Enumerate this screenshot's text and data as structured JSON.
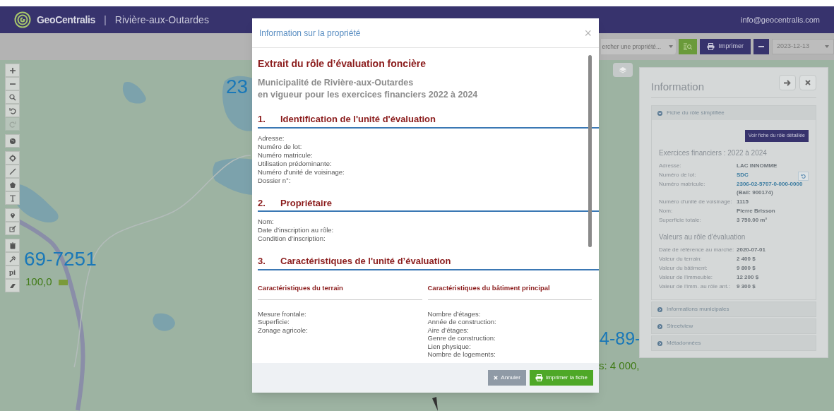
{
  "header": {
    "brand": "GeoCentralis",
    "separator": "|",
    "municipality": "Rivière-aux-Outardes",
    "email": "info@geocentralis.com"
  },
  "toolbar": {
    "search": {
      "value": "ercher une propriété..."
    },
    "print_button": "Imprimer",
    "date": {
      "value": "2023-12-13"
    }
  },
  "map": {
    "labels": [
      {
        "text": "23",
        "kind": "lot"
      },
      {
        "text": "69-7251",
        "kind": "lot"
      },
      {
        "text": "100,0",
        "kind": "measure"
      },
      {
        "text": "4-89-",
        "kind": "lot"
      },
      {
        "text": "s: 4 000,",
        "kind": "measure"
      }
    ],
    "tools": [
      {
        "kind": "plus",
        "disabled": false
      },
      {
        "kind": "minus",
        "disabled": false
      },
      {
        "kind": "search",
        "disabled": false
      },
      {
        "kind": "undo",
        "disabled": false
      },
      {
        "kind": "redo",
        "disabled": true
      },
      {
        "kind": "globe",
        "disabled": false
      },
      {
        "kind": "crosshair",
        "disabled": false
      },
      {
        "kind": "line",
        "disabled": false
      },
      {
        "kind": "polygon",
        "disabled": false
      },
      {
        "kind": "text-tool",
        "disabled": false
      },
      {
        "kind": "marker",
        "disabled": false
      },
      {
        "kind": "edit",
        "disabled": false
      },
      {
        "kind": "trash",
        "disabled": false
      },
      {
        "kind": "pin-tool",
        "disabled": false
      },
      {
        "kind": "label",
        "label": "pi",
        "disabled": false
      },
      {
        "kind": "eraser",
        "disabled": false
      }
    ]
  },
  "info_panel": {
    "title": "Information",
    "sections": [
      {
        "title": "Fiche du rôle simplifiée",
        "expanded": true
      },
      {
        "title": "Informations municipales",
        "expanded": false
      },
      {
        "title": "Streetview",
        "expanded": false
      },
      {
        "title": "Métadonnées",
        "expanded": false
      }
    ],
    "detail_button": "Voir fiche du rôle détaillée",
    "fiscal_years": "Exercices financiers : 2022 à 2024",
    "fields": [
      {
        "label": "Adresse:",
        "value": "LAC INNOMME",
        "kind": "plain"
      },
      {
        "label": "Numéro de lot:",
        "value": "SDC",
        "kind": "link"
      },
      {
        "label": "Numéro matricule:",
        "value": "2306-02-5707-0-000-0000",
        "note": "(Bail: 900174)",
        "kind": "link"
      },
      {
        "label": "Numéro d'unité de voisinage:",
        "value": "1115",
        "kind": "plain"
      },
      {
        "label": "Nom:",
        "value": "Pierre Brisson",
        "kind": "plain"
      },
      {
        "label": "Superficie totale:",
        "value": "3 750.00 m²",
        "kind": "plain"
      }
    ],
    "values_title": "Valeurs au rôle d'évaluation",
    "values": [
      {
        "label": "Date de référence au marché:",
        "value": "2020-07-01"
      },
      {
        "label": "Valeur du terrain:",
        "value": "2 400 $"
      },
      {
        "label": "Valeur du bâtiment:",
        "value": "9 800 $"
      },
      {
        "label": "Valeur de l'immeuble:",
        "value": "12 200 $"
      },
      {
        "label": "Valeur de l'imm. au rôle ant.:",
        "value": "9 300 $"
      }
    ]
  },
  "modal": {
    "title": "Information sur la propriété",
    "close": "×",
    "heading": "Extrait du rôle d’évaluation foncière",
    "subheading": [
      "Municipalité de **Rivière-aux-Outardes**",
      "en vigueur pour les exercices financiers **2022 à 2024**"
    ],
    "sections": [
      {
        "number": "1.",
        "title": "Identification de l'unité d'évaluation",
        "fields": [
          "Adresse:",
          "Numéro de lot:",
          "Numéro matricule:",
          "Utilisation prédominante:",
          "Numéro d'unité de voisinage:",
          "Dossier n°:"
        ]
      },
      {
        "number": "2.",
        "title": "Propriétaire",
        "fields": [
          "Nom:",
          "Date d’inscription au rôle:",
          "Condition d’inscription:"
        ]
      },
      {
        "number": "3.",
        "title": "Caractéristiques de l'unité d’évaluation",
        "columns": [
          {
            "title": "Caractéristiques du terrain",
            "fields": [
              "Mesure frontale:",
              "Superficie:",
              "Zonage agricole:"
            ]
          },
          {
            "title": "Caractéristiques du bâtiment principal",
            "fields": [
              "Nombre d’étages:",
              "Année de construction:",
              "Aire d’étages:",
              "Genre de construction:",
              "Lien physique:",
              "Nombre de logements:"
            ]
          }
        ]
      }
    ],
    "buttons": [
      {
        "label": "Annuler",
        "kind": "cancel",
        "disabled": true
      },
      {
        "label": "Imprimer la fiche",
        "kind": "print",
        "disabled": false
      }
    ]
  }
}
